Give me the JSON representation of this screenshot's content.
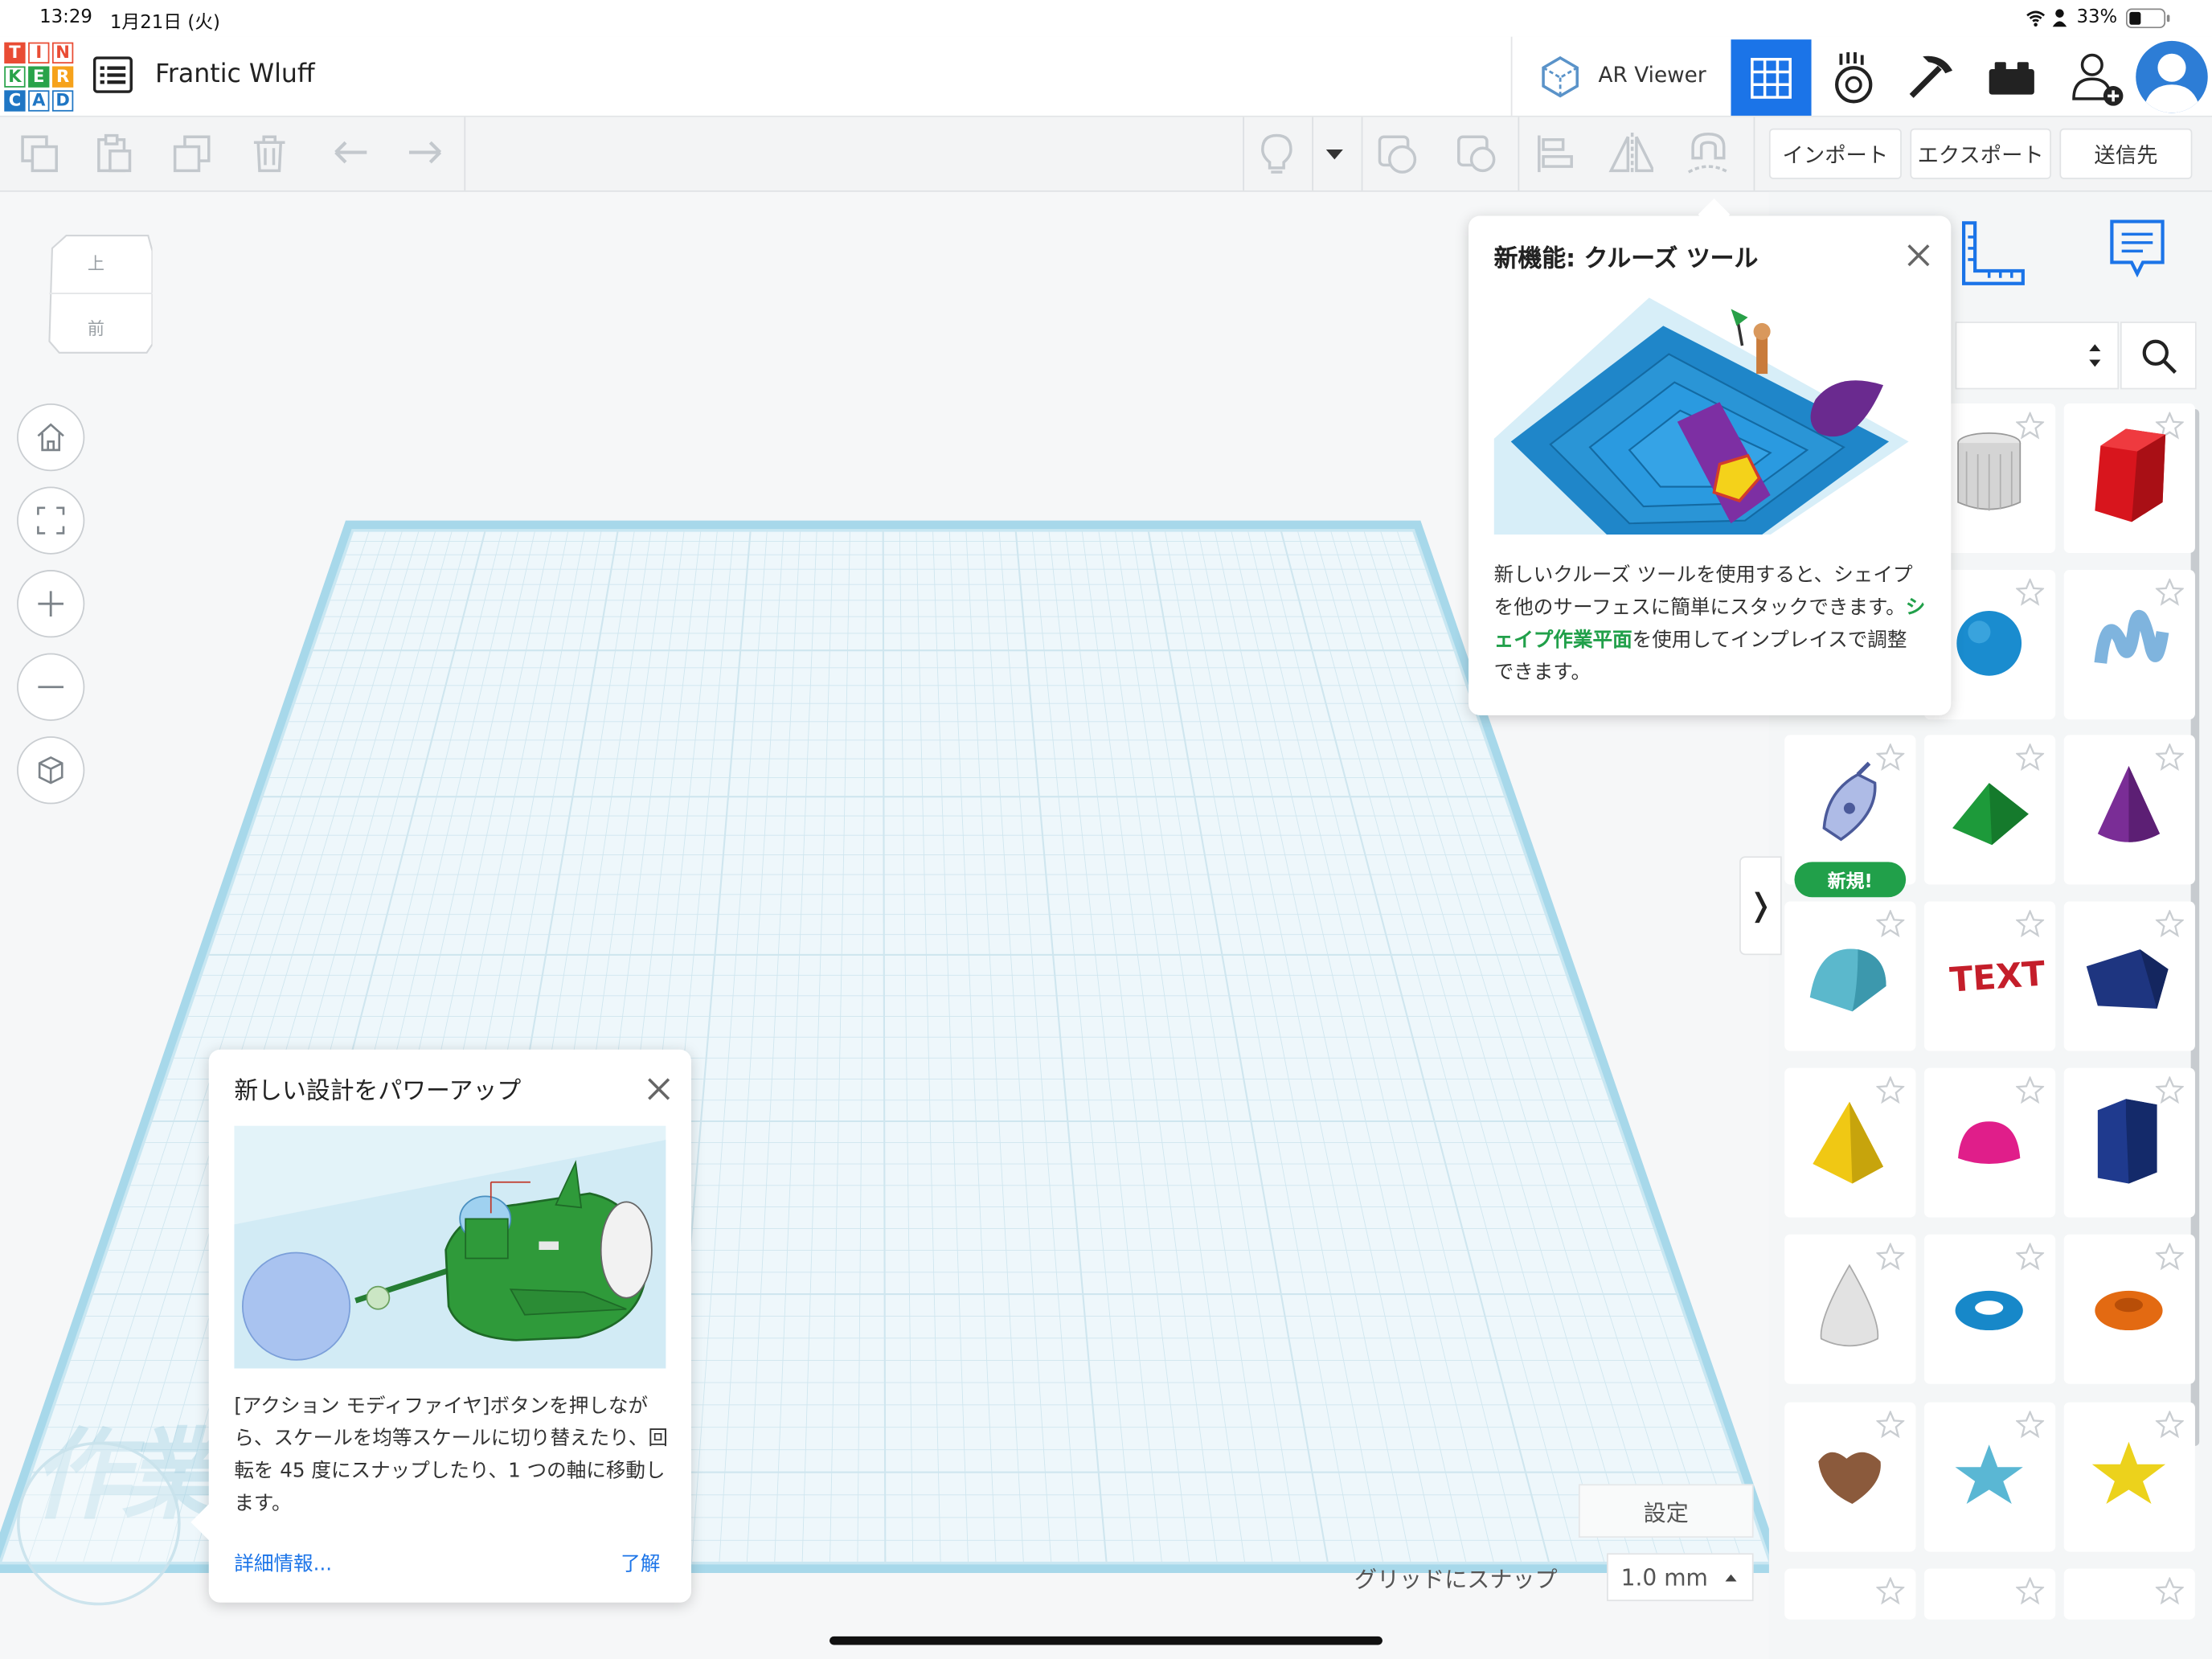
{
  "status": {
    "time": "13:29",
    "date": "1月21日 (火)",
    "battery": "33%"
  },
  "app": {
    "logo_letters": [
      "T",
      "I",
      "N",
      "K",
      "E",
      "R",
      "C",
      "A",
      "D"
    ],
    "design_name": "Frantic Wluff",
    "ar_viewer_label": "AR Viewer"
  },
  "toolbar": {
    "import_label": "インポート",
    "export_label": "エクスポート",
    "send_label": "送信先"
  },
  "viewcube": {
    "top": "上",
    "front": "前"
  },
  "popup_cruise": {
    "title": "新機能: クルーズ ツール",
    "text_1": "新しいクルーズ ツールを使用すると、シェイプを他のサーフェスに簡単にスタックできます。",
    "highlight": "シェイプ作業平面",
    "text_2": "を使用してインプレイスで調整できます。"
  },
  "popup_powerup": {
    "title": "新しい設計をパワーアップ",
    "body": "[アクション モディファイヤ]ボタンを押しながら、スケールを均等スケールに切り替えたり、回転を 45 度にスナップしたり、1 つの軸に移動します。",
    "link": "詳細情報...",
    "ok": "了解"
  },
  "shapes": {
    "new_badge": "新規!",
    "collapse_glyph": "❭"
  },
  "workplane": {
    "watermark": "作業",
    "settings_label": "設定",
    "snap_label": "グリッドにスナップ",
    "snap_value": "1.0 mm"
  },
  "colors": {
    "accent": "#1b74e8",
    "green": "#21a04a",
    "grid_line": "#cfe6ef",
    "border": "#a7d8ea"
  }
}
